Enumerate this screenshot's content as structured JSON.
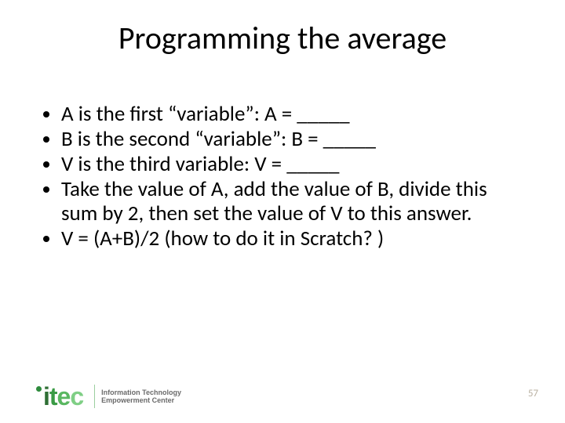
{
  "title": "Programming the average",
  "bullets": [
    "A is the first “variable”: A = _____",
    "B is the second “variable”: B = _____",
    "V is the third variable: V = _____",
    "Take the value of A, add the value of B, divide this sum by 2, then set the value of V to this answer.",
    " V = (A+B)/2  (how to do it in Scratch? )"
  ],
  "logo": {
    "text": "itec",
    "tagline_line1": "Information Technology",
    "tagline_line2": "Empowerment Center"
  },
  "page_number": "57"
}
